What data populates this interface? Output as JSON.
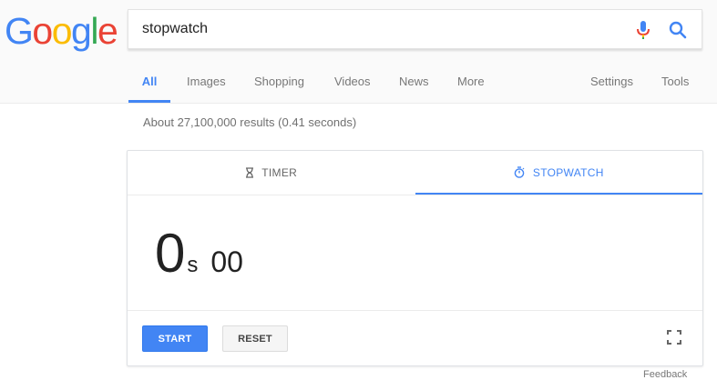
{
  "logo": {
    "text": "Google"
  },
  "search": {
    "query": "stopwatch"
  },
  "nav": {
    "all": "All",
    "images": "Images",
    "shopping": "Shopping",
    "videos": "Videos",
    "news": "News",
    "more": "More",
    "settings": "Settings",
    "tools": "Tools"
  },
  "stats": "About 27,100,000 results (0.41 seconds)",
  "widget": {
    "tab_timer": "TIMER",
    "tab_stopwatch": "STOPWATCH",
    "seconds": "0",
    "seconds_unit": "s",
    "hundredths": "00",
    "start_label": "START",
    "reset_label": "RESET"
  },
  "feedback": "Feedback",
  "colors": {
    "accent": "#4285f4",
    "logo_blue": "#4285f4",
    "logo_red": "#ea4335",
    "logo_yellow": "#fbbc05",
    "logo_green": "#34a853"
  },
  "icons": {
    "mic": "microphone-icon",
    "search": "search-icon",
    "timer": "hourglass-icon",
    "stopwatch": "stopwatch-icon",
    "fullscreen": "fullscreen-icon"
  }
}
